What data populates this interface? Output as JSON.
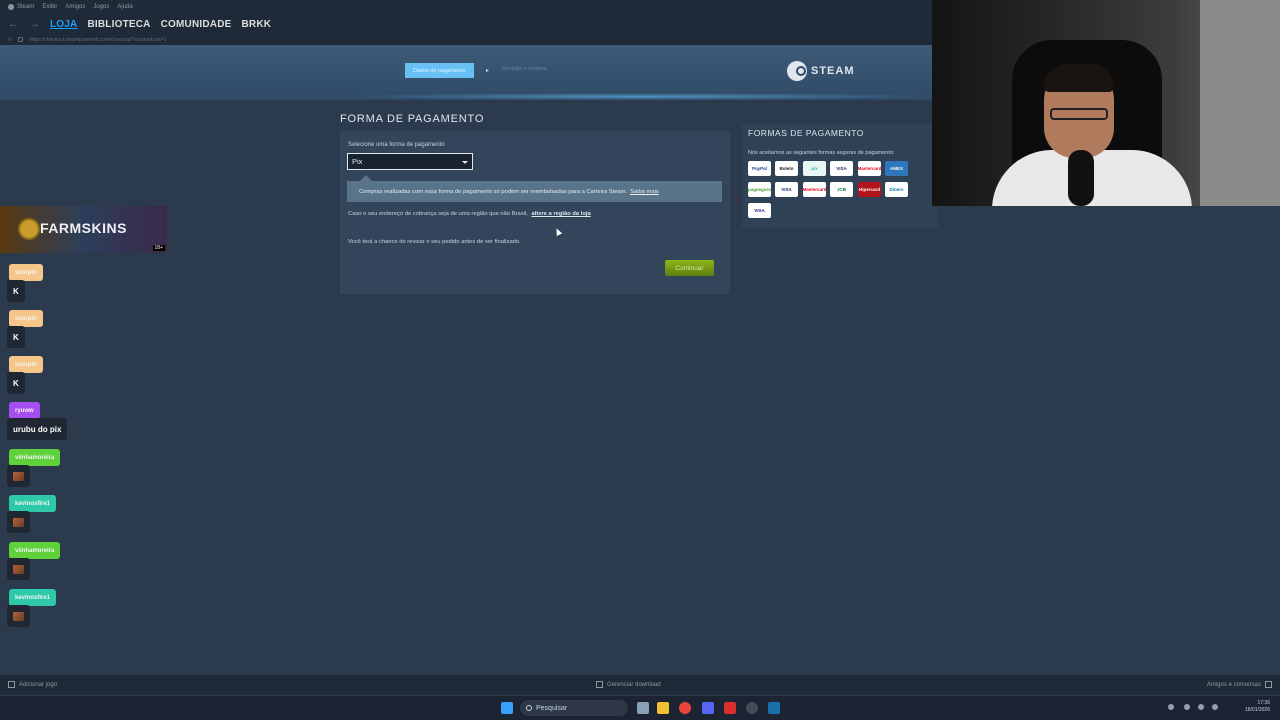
{
  "menu": {
    "items": [
      "Steam",
      "Exibir",
      "Amigos",
      "Jogos",
      "Ajuda"
    ]
  },
  "nav": {
    "items": [
      "LOJA",
      "BIBLIOTECA",
      "COMUNIDADE",
      "BRKK"
    ],
    "active": "LOJA"
  },
  "url": "https://checkout.steampowered.com/checkout/?accountcart=1",
  "checkout": {
    "step1": "Dados de pagamento",
    "step2": "Revisão + compra",
    "brand": "STEAM",
    "section_title": "FORMA DE PAGAMENTO",
    "select_label": "Selecione uma forma de pagamento",
    "selected_method": "Pix",
    "notice": "Compras realizadas com essa forma de pagamento só podem ser reembolsadas para a Carteira Steam.",
    "notice_link": "Saiba mais",
    "region_text": "Caso o seu endereço de cobrança seja de uma região que não Brasil,",
    "region_link": "altere a região da loja",
    "review_text": "Você terá a chance de revisar o seu pedido antes de ser finalizado.",
    "continue": "Continuar"
  },
  "methods": {
    "title": "FORMAS DE PAGAMENTO",
    "description": "Nós aceitamos as seguintes formas seguras de pagamento:",
    "logos": [
      {
        "name": "PayPal",
        "bg": "#ffffff",
        "fg": "#1a3d8f"
      },
      {
        "name": "Boleto",
        "bg": "#ffffff",
        "fg": "#222222"
      },
      {
        "name": "pix",
        "bg": "#e6f7f4",
        "fg": "#32bcad"
      },
      {
        "name": "VISA",
        "bg": "#ffffff",
        "fg": "#1a1f71"
      },
      {
        "name": "Mastercard",
        "bg": "#ffffff",
        "fg": "#eb001b"
      },
      {
        "name": "AMEX",
        "bg": "#2e77bc",
        "fg": "#ffffff"
      },
      {
        "name": "pagseguro",
        "bg": "#ffffff",
        "fg": "#4a9a3a"
      },
      {
        "name": "VISA",
        "bg": "#ffffff",
        "fg": "#1a1f71"
      },
      {
        "name": "Mastercard",
        "bg": "#ffffff",
        "fg": "#eb001b"
      },
      {
        "name": "JCB",
        "bg": "#ffffff",
        "fg": "#0a7a3a"
      },
      {
        "name": "Hipercard",
        "bg": "#b3131b",
        "fg": "#ffffff"
      },
      {
        "name": "Diners",
        "bg": "#ffffff",
        "fg": "#0079be"
      },
      {
        "name": "VISA",
        "bg": "#ffffff",
        "fg": "#1a1f71"
      }
    ]
  },
  "overlay": {
    "banner": "FARMSKINS",
    "banner_badge": "18+",
    "chat": [
      {
        "user": "scorpio",
        "msg": "K",
        "color": "#f5c58a",
        "emote": false
      },
      {
        "user": "scorpio",
        "msg": "K",
        "color": "#f5c58a",
        "emote": false
      },
      {
        "user": "scorpio",
        "msg": "K",
        "color": "#f5c58a",
        "emote": false
      },
      {
        "user": "ryuww",
        "msg": "urubu do pix",
        "color": "#a64df0",
        "emote": false
      },
      {
        "user": "viinhamoreira",
        "msg": "",
        "color": "#5fd13a",
        "emote": true
      },
      {
        "user": "kevinosfire1",
        "msg": "",
        "color": "#2ec9a8",
        "emote": true
      },
      {
        "user": "viinhamoreira",
        "msg": "",
        "color": "#5fd13a",
        "emote": true
      },
      {
        "user": "kevinosfire1",
        "msg": "",
        "color": "#2ec9a8",
        "emote": true
      }
    ]
  },
  "status": {
    "add_game": "Adicionar jogo",
    "downloads": "Gerenciar download",
    "friends": "Amigos e conversas"
  },
  "taskbar": {
    "search": "Pesquisar",
    "time": "17:36",
    "date": "18/01/2026"
  }
}
